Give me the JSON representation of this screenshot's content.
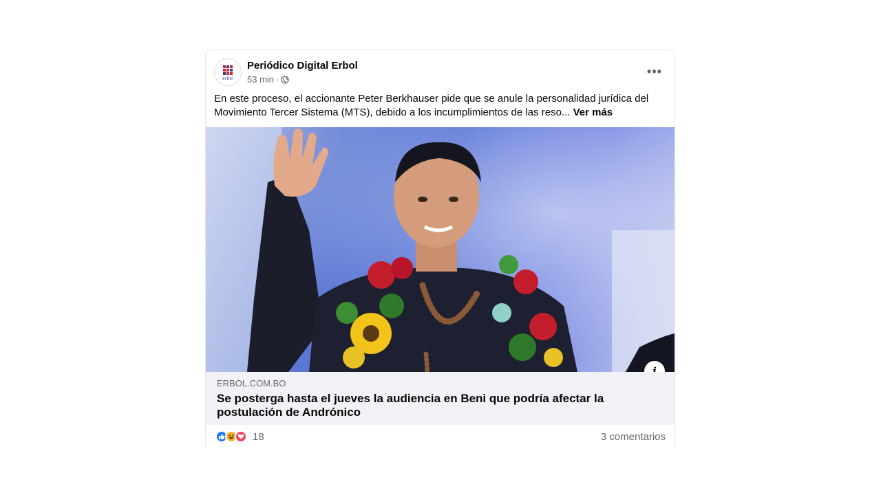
{
  "post": {
    "page_name": "Periódico Digital Erbol",
    "logo_text": "erbol",
    "time": "53 min",
    "separator": "·",
    "privacy_icon": "globe-icon",
    "more_icon": "more-options-icon",
    "more_label": "•••",
    "text": "En este proceso, el accionante Peter Berkhauser pide que se anule la personalidad jurídica del Movimiento Tercer Sistema (MTS), debido a los incumplimientos de las reso...",
    "see_more": "Ver más"
  },
  "link_preview": {
    "info_label": "i",
    "domain": "ERBOL.COM.BO",
    "headline": "Se posterga hasta el jueves la audiencia en Beni que podría afectar la postulación de Andrónico"
  },
  "footer": {
    "reactions": [
      "like-reaction-icon",
      "haha-reaction-icon",
      "love-reaction-icon"
    ],
    "reaction_count": "18",
    "comments": "3 comentarios"
  },
  "colors": {
    "brand_red": "#d1232a",
    "brand_blue": "#2d3e8c",
    "like": "#1877f2",
    "haha": "#f7b125",
    "love": "#f33e58",
    "secondary_text": "#65676b",
    "link_box_bg": "#f0f2f5"
  }
}
